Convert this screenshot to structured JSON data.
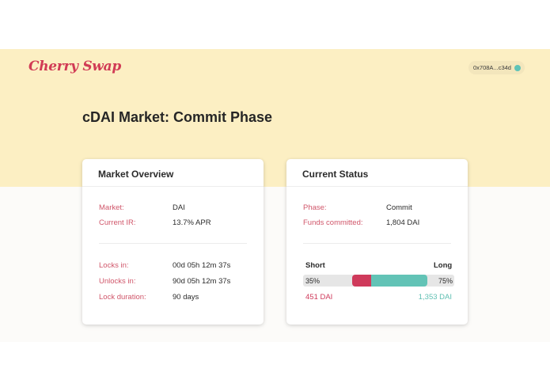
{
  "header": {
    "logo": "Cherry Swap",
    "wallet_address": "0x708A...c34d"
  },
  "page": {
    "title": "cDAI Market: Commit Phase"
  },
  "market_overview": {
    "title": "Market Overview",
    "market_label": "Market:",
    "market_value": "DAI",
    "ir_label": "Current IR:",
    "ir_value": "13.7% APR",
    "locks_label": "Locks in:",
    "locks_value": "00d 05h 12m 37s",
    "unlocks_label": "Unlocks in:",
    "unlocks_value": "90d 05h 12m 37s",
    "duration_label": "Lock duration:",
    "duration_value": "90 days"
  },
  "current_status": {
    "title": "Current Status",
    "phase_label": "Phase:",
    "phase_value": "Commit",
    "funds_label": "Funds committed:",
    "funds_value": "1,804 DAI",
    "short_label": "Short",
    "long_label": "Long",
    "short_pct": "35%",
    "long_pct": "75%",
    "short_amount": "451 DAI",
    "long_amount": "1,353 DAI",
    "short_fraction": 0.25,
    "long_fraction": 0.75
  },
  "colors": {
    "accent": "#d13b55",
    "short": "#cf3a5b",
    "long": "#62c3b6",
    "hero_bg": "#fcefc3"
  }
}
